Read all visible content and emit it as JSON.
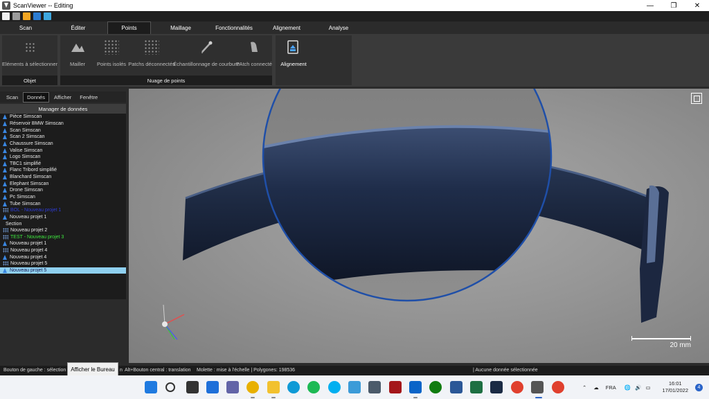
{
  "window": {
    "title": "ScanViewer  --  Editing",
    "controls": [
      "—",
      "❐",
      "✕"
    ]
  },
  "ribbon": {
    "tabs": [
      {
        "label": "Scan"
      },
      {
        "label": "Éditer"
      },
      {
        "label": "Points",
        "active": true
      },
      {
        "label": "Maillage"
      },
      {
        "label": "Fonctionnalités"
      },
      {
        "label": "Alignement"
      },
      {
        "label": "Analyse"
      }
    ],
    "groups": {
      "objet": {
        "label": "Objet",
        "buttons": [
          {
            "label": "Eléments à sélectionner",
            "icon": "select-elements-icon"
          }
        ]
      },
      "nuage": {
        "label": "Nuage de points",
        "buttons": [
          {
            "label": "Mailler",
            "icon": "mesh-icon"
          },
          {
            "label": "Points isolés",
            "icon": "isolated-points-icon"
          },
          {
            "label": "Patchs déconnectés",
            "icon": "disconnected-patches-icon"
          },
          {
            "label": "Échantillonnage de courbure",
            "icon": "curvature-sampling-icon"
          },
          {
            "label": "PAtch connecté",
            "icon": "connected-patch-icon"
          }
        ]
      },
      "alignement": {
        "buttons": [
          {
            "label": "Alignement",
            "icon": "alignment-icon"
          }
        ]
      }
    }
  },
  "left_panel": {
    "tabs": [
      {
        "label": "Scan"
      },
      {
        "label": "Donnés",
        "active": true
      },
      {
        "label": "Afficher"
      },
      {
        "label": "Fenêtre"
      }
    ],
    "header": "Manager de données",
    "items": [
      {
        "label": "Pièce Simscan",
        "type": "mesh"
      },
      {
        "label": "Réservoir BMW Simscan",
        "type": "mesh"
      },
      {
        "label": "Scan Simscan",
        "type": "mesh"
      },
      {
        "label": "Scan 2 Simscan",
        "type": "mesh"
      },
      {
        "label": "Chaussure Simscan",
        "type": "mesh"
      },
      {
        "label": "Valise Simscan",
        "type": "mesh"
      },
      {
        "label": "Logo Simscan",
        "type": "mesh"
      },
      {
        "label": "TBC1 simplifié",
        "type": "mesh"
      },
      {
        "label": "Flanc Tribord simplifié",
        "type": "mesh"
      },
      {
        "label": "Blanchard Simscan",
        "type": "mesh"
      },
      {
        "label": "Elephant Simscan",
        "type": "mesh"
      },
      {
        "label": "Drone Simscan",
        "type": "mesh"
      },
      {
        "label": "Pc Simscan",
        "type": "mesh"
      },
      {
        "label": "Tube Simscan",
        "type": "mesh"
      },
      {
        "label": "BOL - Nouveau projet 1",
        "type": "points",
        "style": "blue"
      },
      {
        "label": "Nouveau projet 1",
        "type": "mesh"
      },
      {
        "label": "Section",
        "type": "none"
      },
      {
        "label": "Nouveau projet 2",
        "type": "points"
      },
      {
        "label": "TEST - Nouveau projet 3",
        "type": "points",
        "style": "green"
      },
      {
        "label": "Nouveau projet 1",
        "type": "mesh"
      },
      {
        "label": "Nouveau projet 4",
        "type": "points"
      },
      {
        "label": "Nouveau projet 4",
        "type": "mesh"
      },
      {
        "label": "Nouveau projet 5",
        "type": "points"
      },
      {
        "label": "Nouveau projet 5",
        "type": "mesh",
        "style": "selected"
      }
    ]
  },
  "viewport": {
    "scale_label": "20 mm",
    "fit_icon": "fit-view-icon"
  },
  "status": {
    "left": "Bouton de gauche : sélection",
    "tooltip": "Afficher le Bureau",
    "mid": "n",
    "pan": "Alt+Bouton central : translation",
    "wheel": "Molette : mise à l'échelle | Polygones: 198536",
    "right": "| Aucune donnée sélectionnée"
  },
  "taskbar": {
    "lang": "FRA",
    "time": "16:01",
    "date": "17/01/2022",
    "notifications": "4"
  },
  "colors": {
    "accent": "#3a86e0",
    "selected_bg": "#8fd0f0",
    "green": "#3ee83e",
    "lens_ring": "#1f4fa8"
  }
}
